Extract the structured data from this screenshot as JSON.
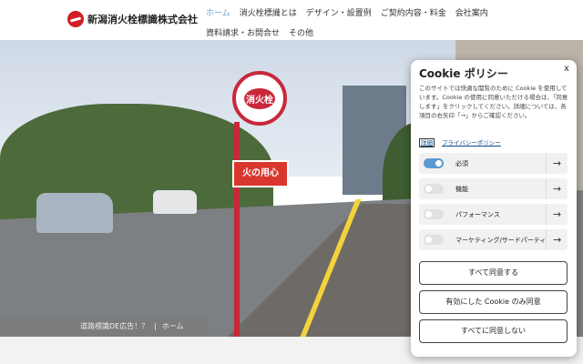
{
  "header": {
    "logo_text": "新潟消火栓標識株式会社",
    "nav": [
      "ホーム",
      "消火栓標識とは",
      "デザイン・設置例",
      "ご契約内容・料金",
      "会社案内",
      "資料請求・お問合せ",
      "その他"
    ]
  },
  "hero": {
    "sign_text": "消火栓",
    "board_text": "火の用心",
    "caption": {
      "left": "道路標識DE広告！？",
      "sep": "|",
      "right": "ホーム"
    }
  },
  "cookie": {
    "title": "Cookie ポリシー",
    "close": "x",
    "description": "このサイトでは快適な閲覧のために Cookie を使用しています。Cookie の使用に同意いただける場合は、「同意します」をクリックしてください。詳細については、各項目の右矢印「→」からご確認ください。",
    "details_link": "詳細",
    "policy_link": "プライバシーポリシー",
    "categories": [
      {
        "label": "必須",
        "on": true
      },
      {
        "label": "機能",
        "on": false
      },
      {
        "label": "パフォーマンス",
        "on": false
      },
      {
        "label": "マーケティング/サードパーティ",
        "on": false
      }
    ],
    "arrow": "→",
    "buttons": {
      "accept_all": "すべて同意する",
      "accept_enabled": "有効にした Cookie のみ同意",
      "reject_all": "すべてに同意しない"
    }
  },
  "colors": {
    "accent": "#5c9ad0",
    "brand_red": "#d21f26"
  }
}
